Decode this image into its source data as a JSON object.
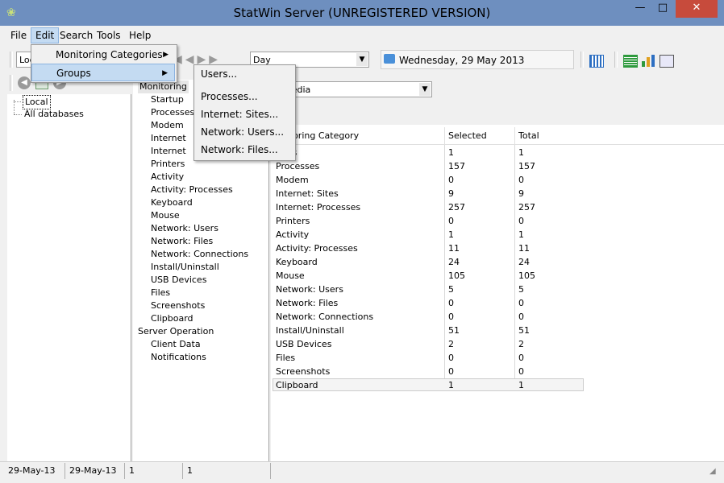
{
  "window": {
    "title": "StatWin Server (UNREGISTERED VERSION)",
    "min_glyph": "—",
    "max_glyph": "□",
    "close_glyph": "✕",
    "app_icon_glyph": "❀"
  },
  "menubar": {
    "items": [
      "File",
      "Edit",
      "Search",
      "Tools",
      "Help"
    ]
  },
  "edit_menu": {
    "items": [
      "Monitoring Categories",
      "Groups"
    ],
    "arrow": "▶"
  },
  "groups_submenu": {
    "items": [
      "Users...",
      "Processes...",
      "Internet: Sites...",
      "Network: Users...",
      "Network: Files..."
    ]
  },
  "toolbar": {
    "location_value": "Loc",
    "period_value": "Day",
    "date_label": "Wednesday, 29 May 2013",
    "combo_arrow": "▼",
    "nav_back_glyph": "◀",
    "nav_fwd_glyph": "▶"
  },
  "tree": {
    "items": [
      "Local",
      "All databases"
    ]
  },
  "categories": {
    "header": "Monitoring",
    "items": [
      "Startup",
      "Processes",
      "Modem",
      "Internet",
      "Internet",
      "Printers",
      "Activity",
      "Activity: Processes",
      "Keyboard",
      "Mouse",
      "Network: Users",
      "Network: Files",
      "Network: Connections",
      "Install/Uninstall",
      "USB Devices",
      "Files",
      "Screenshots",
      "Clipboard"
    ],
    "server_header": "Server Operation",
    "server_items": [
      "Client Data",
      "Notifications"
    ]
  },
  "group_combo": {
    "value": "oftpedia"
  },
  "table": {
    "columns": [
      "onitoring Category",
      "Selected",
      "Total"
    ],
    "rows": [
      [
        "oups",
        "1",
        "1"
      ],
      [
        "Processes",
        "157",
        "157"
      ],
      [
        "Modem",
        "0",
        "0"
      ],
      [
        "Internet: Sites",
        "9",
        "9"
      ],
      [
        "Internet: Processes",
        "257",
        "257"
      ],
      [
        "Printers",
        "0",
        "0"
      ],
      [
        "Activity",
        "1",
        "1"
      ],
      [
        "Activity: Processes",
        "11",
        "11"
      ],
      [
        "Keyboard",
        "24",
        "24"
      ],
      [
        "Mouse",
        "105",
        "105"
      ],
      [
        "Network: Users",
        "5",
        "5"
      ],
      [
        "Network: Files",
        "0",
        "0"
      ],
      [
        "Network: Connections",
        "0",
        "0"
      ],
      [
        "Install/Uninstall",
        "51",
        "51"
      ],
      [
        "USB Devices",
        "2",
        "2"
      ],
      [
        "Files",
        "0",
        "0"
      ],
      [
        "Screenshots",
        "0",
        "0"
      ],
      [
        "Clipboard",
        "1",
        "1"
      ]
    ]
  },
  "statusbar": {
    "cells": [
      "29-May-13",
      "29-May-13",
      "1",
      "1"
    ]
  },
  "colors": {
    "titlebar": "#6e8fbf",
    "close": "#c74b3c",
    "highlight": "#c4dbf2"
  }
}
